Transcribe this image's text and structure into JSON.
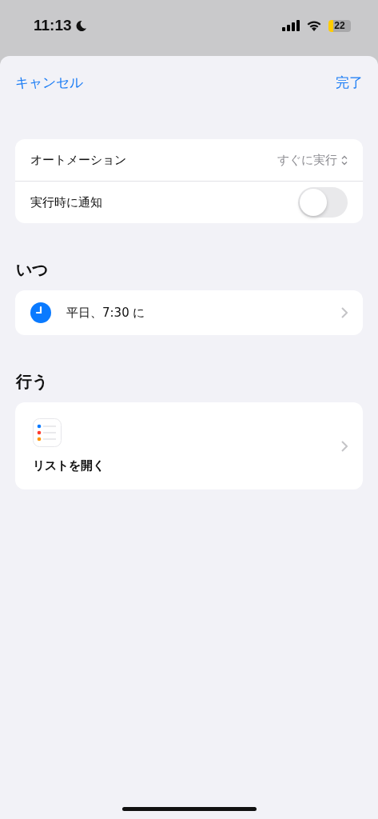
{
  "status_bar": {
    "time": "11:13",
    "battery": "22"
  },
  "nav": {
    "cancel": "キャンセル",
    "done": "完了"
  },
  "settings": [
    {
      "kind": "picker",
      "label": "オートメーション",
      "value": "すぐに実行"
    },
    {
      "kind": "toggle",
      "label": "実行時に通知",
      "on": false
    }
  ],
  "when": {
    "title": "いつ",
    "trigger": "平日、7:30 に"
  },
  "do": {
    "title": "行う",
    "action": "リストを開く"
  }
}
